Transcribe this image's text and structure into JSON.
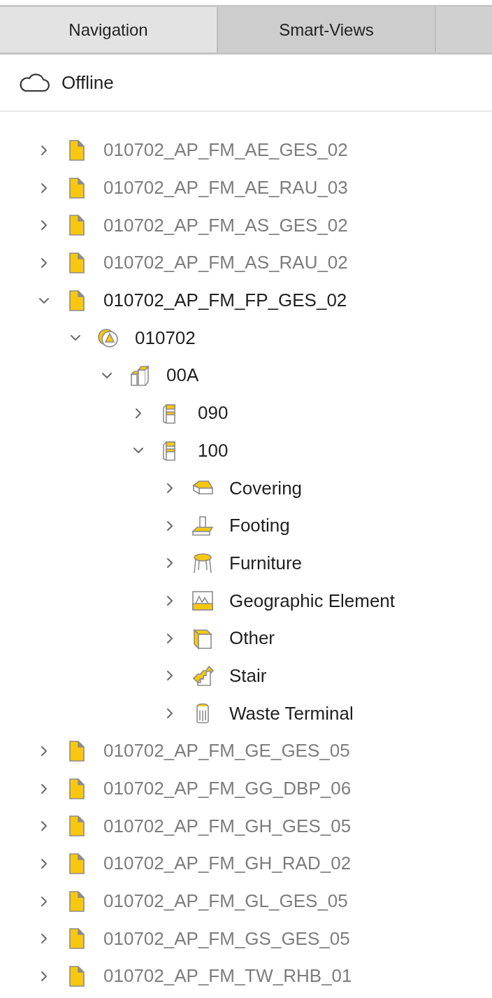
{
  "tabs": [
    {
      "label": "Navigation",
      "selected": true
    },
    {
      "label": "Smart-Views",
      "selected": false
    }
  ],
  "status": {
    "label": "Offline"
  },
  "tree": [
    {
      "label": "010702_AP_FM_AE_GES_02",
      "kind": "model",
      "loaded": false,
      "expanded": false
    },
    {
      "label": "010702_AP_FM_AE_RAU_03",
      "kind": "model",
      "loaded": false,
      "expanded": false
    },
    {
      "label": "010702_AP_FM_AS_GES_02",
      "kind": "model",
      "loaded": false,
      "expanded": false
    },
    {
      "label": "010702_AP_FM_AS_RAU_02",
      "kind": "model",
      "loaded": false,
      "expanded": false
    },
    {
      "label": "010702_AP_FM_FP_GES_02",
      "kind": "model",
      "loaded": true,
      "expanded": true,
      "children": [
        {
          "label": "010702",
          "kind": "site",
          "loaded": true,
          "expanded": true,
          "children": [
            {
              "label": "00A",
              "kind": "building",
              "loaded": true,
              "expanded": true,
              "children": [
                {
                  "label": "090",
                  "kind": "storey",
                  "loaded": true,
                  "expanded": false
                },
                {
                  "label": "100",
                  "kind": "storey",
                  "loaded": true,
                  "expanded": true,
                  "children": [
                    {
                      "label": "Covering",
                      "kind": "covering",
                      "loaded": true,
                      "expanded": false
                    },
                    {
                      "label": "Footing",
                      "kind": "footing",
                      "loaded": true,
                      "expanded": false
                    },
                    {
                      "label": "Furniture",
                      "kind": "furniture",
                      "loaded": true,
                      "expanded": false
                    },
                    {
                      "label": "Geographic Element",
                      "kind": "geographic",
                      "loaded": true,
                      "expanded": false
                    },
                    {
                      "label": "Other",
                      "kind": "other",
                      "loaded": true,
                      "expanded": false
                    },
                    {
                      "label": "Stair",
                      "kind": "stair",
                      "loaded": true,
                      "expanded": false
                    },
                    {
                      "label": "Waste Terminal",
                      "kind": "waste",
                      "loaded": true,
                      "expanded": false
                    }
                  ]
                }
              ]
            }
          ]
        }
      ]
    },
    {
      "label": "010702_AP_FM_GE_GES_05",
      "kind": "model",
      "loaded": false,
      "expanded": false
    },
    {
      "label": "010702_AP_FM_GG_DBP_06",
      "kind": "model",
      "loaded": false,
      "expanded": false
    },
    {
      "label": "010702_AP_FM_GH_GES_05",
      "kind": "model",
      "loaded": false,
      "expanded": false
    },
    {
      "label": "010702_AP_FM_GH_RAD_02",
      "kind": "model",
      "loaded": false,
      "expanded": false
    },
    {
      "label": "010702_AP_FM_GL_GES_05",
      "kind": "model",
      "loaded": false,
      "expanded": false
    },
    {
      "label": "010702_AP_FM_GS_GES_05",
      "kind": "model",
      "loaded": false,
      "expanded": false
    },
    {
      "label": "010702_AP_FM_TW_RHB_01",
      "kind": "model",
      "loaded": false,
      "expanded": false
    }
  ]
}
